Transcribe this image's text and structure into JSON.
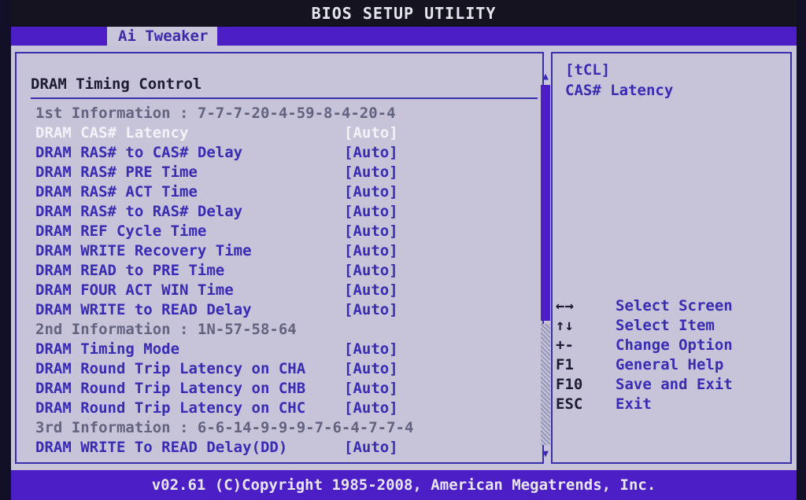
{
  "title": "BIOS SETUP UTILITY",
  "tab_active": "Ai Tweaker",
  "section_title": "DRAM Timing Control",
  "rows": [
    {
      "kind": "info",
      "label": "1st Information : 7-7-7-20-4-59-8-4-20-4",
      "value": ""
    },
    {
      "kind": "selected",
      "label": "DRAM CAS# Latency",
      "value": "[Auto]"
    },
    {
      "kind": "setting",
      "label": "DRAM RAS# to CAS# Delay",
      "value": "[Auto]"
    },
    {
      "kind": "setting",
      "label": "DRAM RAS# PRE Time",
      "value": "[Auto]"
    },
    {
      "kind": "setting",
      "label": "DRAM RAS# ACT Time",
      "value": "[Auto]"
    },
    {
      "kind": "setting",
      "label": "DRAM RAS# to RAS# Delay",
      "value": "[Auto]"
    },
    {
      "kind": "setting",
      "label": "DRAM REF Cycle Time",
      "value": "[Auto]"
    },
    {
      "kind": "setting",
      "label": "DRAM WRITE Recovery Time",
      "value": "[Auto]"
    },
    {
      "kind": "setting",
      "label": "DRAM READ to PRE Time",
      "value": "[Auto]"
    },
    {
      "kind": "setting",
      "label": "DRAM FOUR ACT WIN Time",
      "value": "[Auto]"
    },
    {
      "kind": "setting",
      "label": "DRAM WRITE to READ Delay",
      "value": "[Auto]"
    },
    {
      "kind": "info",
      "label": "2nd Information : 1N-57-58-64",
      "value": ""
    },
    {
      "kind": "setting",
      "label": "DRAM Timing Mode",
      "value": "[Auto]"
    },
    {
      "kind": "setting",
      "label": "DRAM Round Trip Latency on CHA",
      "value": "[Auto]"
    },
    {
      "kind": "setting",
      "label": "DRAM Round Trip Latency on CHB",
      "value": "[Auto]"
    },
    {
      "kind": "setting",
      "label": "DRAM Round Trip Latency on CHC",
      "value": "[Auto]"
    },
    {
      "kind": "info",
      "label": "3rd Information : 6-6-14-9-9-9-7-6-4-7-7-4",
      "value": ""
    },
    {
      "kind": "setting",
      "label": "DRAM WRITE To READ Delay(DD)",
      "value": "[Auto]"
    }
  ],
  "help": {
    "code": "[tCL]",
    "description": "CAS# Latency"
  },
  "keys": [
    {
      "key": "←→",
      "action": "Select Screen"
    },
    {
      "key": "↑↓",
      "action": "Select Item"
    },
    {
      "key": "+-",
      "action": "Change Option"
    },
    {
      "key": "F1",
      "action": "General Help"
    },
    {
      "key": "F10",
      "action": "Save and Exit"
    },
    {
      "key": "ESC",
      "action": "Exit"
    }
  ],
  "footer": "v02.61 (C)Copyright 1985-2008, American Megatrends, Inc.",
  "colors": {
    "background": "#c7c3d9",
    "accent": "#4b1ec6",
    "setting_text": "#3a2cb2",
    "selected_text": "#f4f2f9",
    "info_text": "#636380"
  },
  "icons": {
    "scroll_up": "triangle-up-icon",
    "scroll_down": "triangle-down-icon"
  }
}
